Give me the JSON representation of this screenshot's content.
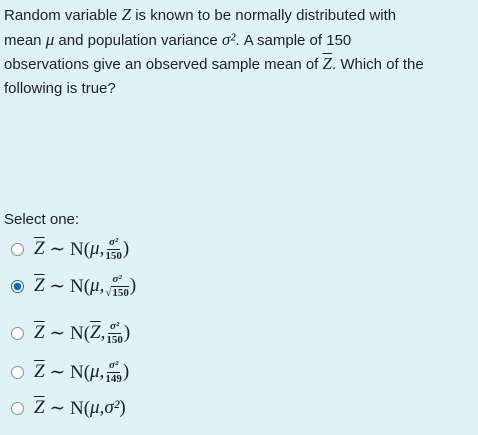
{
  "question": {
    "line1_a": "Random variable ",
    "Z": "Z",
    "line1_b": " is known to be normally distributed with",
    "line2_a": "mean ",
    "mu": "μ",
    "line2_b": " and population variance ",
    "sigma2": "σ²",
    "line2_c": ". A sample of 150",
    "line3_a": "observations give an observed sample mean of ",
    "Zbar": "Z",
    "line3_b": ". Which of the",
    "line4": "following is true?"
  },
  "select_label": "Select one:",
  "options": [
    {
      "lhs": "Z",
      "dist": "∼ N(",
      "mean": "μ",
      "comma": ", ",
      "num": "σ²",
      "den": "150",
      "sqrt": false,
      "close": ")",
      "checked": false
    },
    {
      "lhs": "Z",
      "dist": "∼ N(",
      "mean": "μ",
      "comma": ", ",
      "num": "σ²",
      "den": "150",
      "sqrt": true,
      "close": ")",
      "checked": true
    },
    {
      "lhs": "Z",
      "dist": "∼ N(",
      "mean": "Z",
      "comma": ", ",
      "num": "σ²",
      "den": "150",
      "sqrt": false,
      "close": ")",
      "checked": false
    },
    {
      "lhs": "Z",
      "dist": "∼ N(",
      "mean": "μ",
      "comma": ", ",
      "num": "σ²",
      "den": "149",
      "sqrt": false,
      "close": ")",
      "checked": false
    },
    {
      "lhs": "Z",
      "dist": "∼ N(",
      "mean": "μ",
      "comma": ", ",
      "var": "σ²",
      "close": ")",
      "checked": false
    }
  ],
  "colors": {
    "background": "#def2f8",
    "text": "#1d2125",
    "radio_checked": "#0f6cbf"
  }
}
